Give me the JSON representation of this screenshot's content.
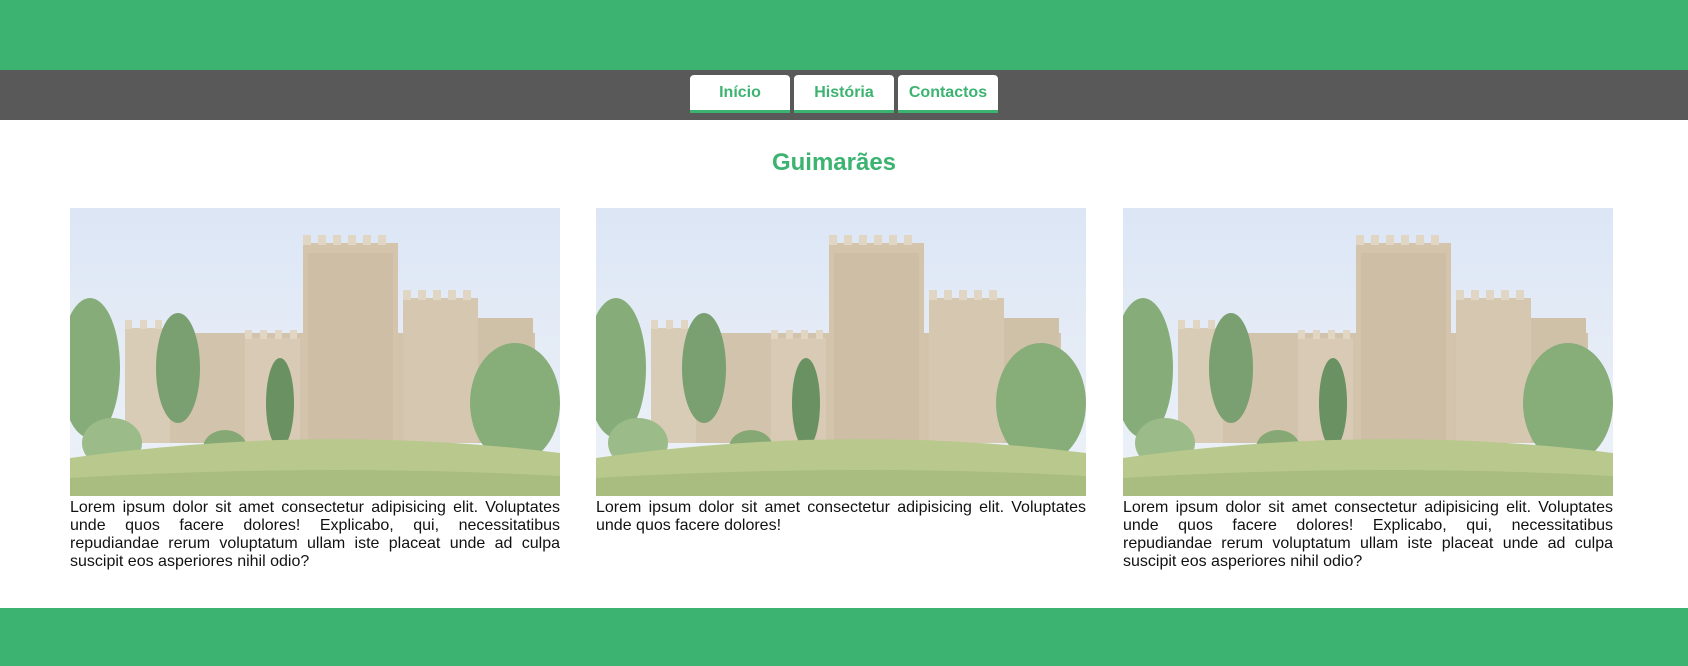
{
  "nav": {
    "items": [
      {
        "label": "Início"
      },
      {
        "label": "História"
      },
      {
        "label": "Contactos"
      }
    ]
  },
  "main": {
    "title": "Guimarães",
    "cards": [
      {
        "text": "Lorem ipsum dolor sit amet consectetur adipisicing elit. Voluptates unde quos facere dolores! Explicabo, qui, necessitatibus repudiandae rerum voluptatum ullam iste placeat unde ad culpa suscipit eos asperiores nihil odio?"
      },
      {
        "text": "Lorem ipsum dolor sit amet consectetur adipisicing elit. Voluptates unde quos facere dolores!"
      },
      {
        "text": "Lorem ipsum dolor sit amet consectetur adipisicing elit. Voluptates unde quos facere dolores! Explicabo, qui, necessitatibus repudiandae rerum voluptatum ullam iste placeat unde ad culpa suscipit eos asperiores nihil odio?"
      }
    ]
  },
  "colors": {
    "accent": "#3cb371",
    "nav_background": "#595959"
  }
}
